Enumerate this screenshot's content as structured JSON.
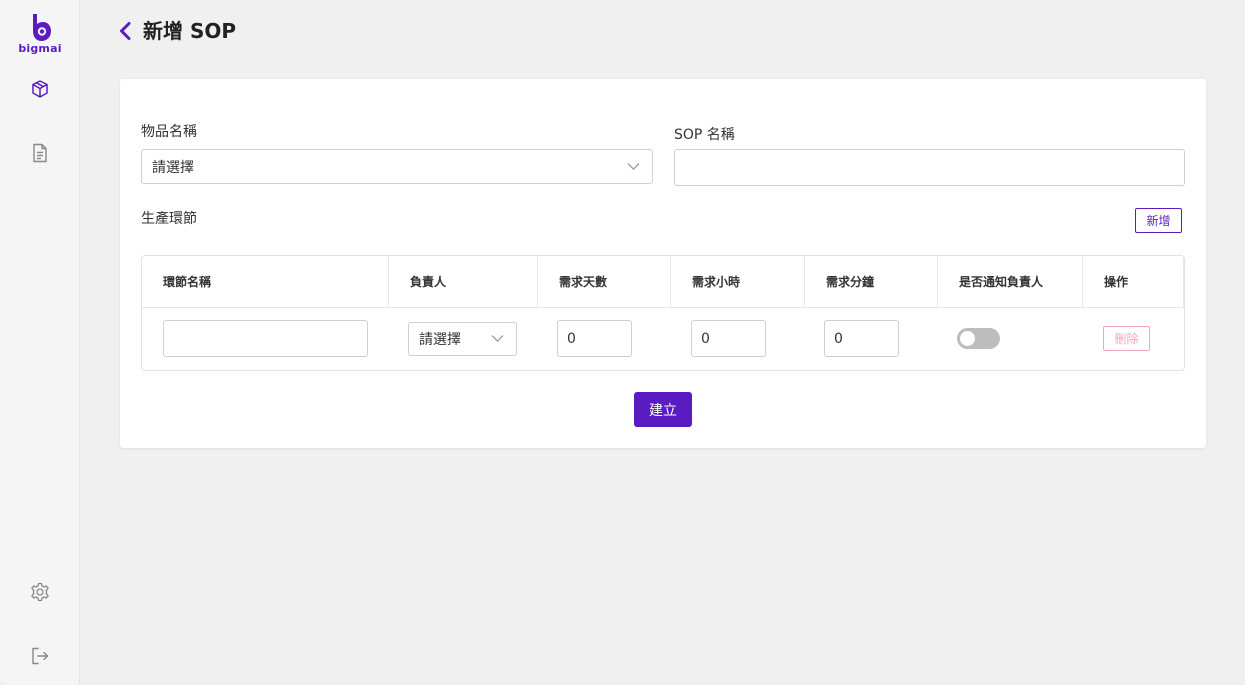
{
  "brand": {
    "name": "bigmai",
    "color": "#5a1cc2"
  },
  "sidebar": {
    "items": [
      {
        "icon": "box-icon"
      },
      {
        "icon": "document-icon"
      },
      {
        "icon": "gear-icon"
      },
      {
        "icon": "logout-icon"
      }
    ]
  },
  "header": {
    "title": "新增 SOP"
  },
  "form": {
    "item_name": {
      "label": "物品名稱",
      "value": "請選擇"
    },
    "sop_name": {
      "label": "SOP 名稱",
      "value": ""
    },
    "stages": {
      "label": "生產環節",
      "add_label": "新增"
    },
    "table": {
      "headers": [
        "環節名稱",
        "負責人",
        "需求天數",
        "需求小時",
        "需求分鐘",
        "是否通知負責人",
        "操作"
      ],
      "rows": [
        {
          "stage_name": "",
          "owner": "請選擇",
          "days": "0",
          "hours": "0",
          "minutes": "0",
          "notify": false,
          "delete_label": "刪除"
        }
      ]
    },
    "submit_label": "建立"
  }
}
